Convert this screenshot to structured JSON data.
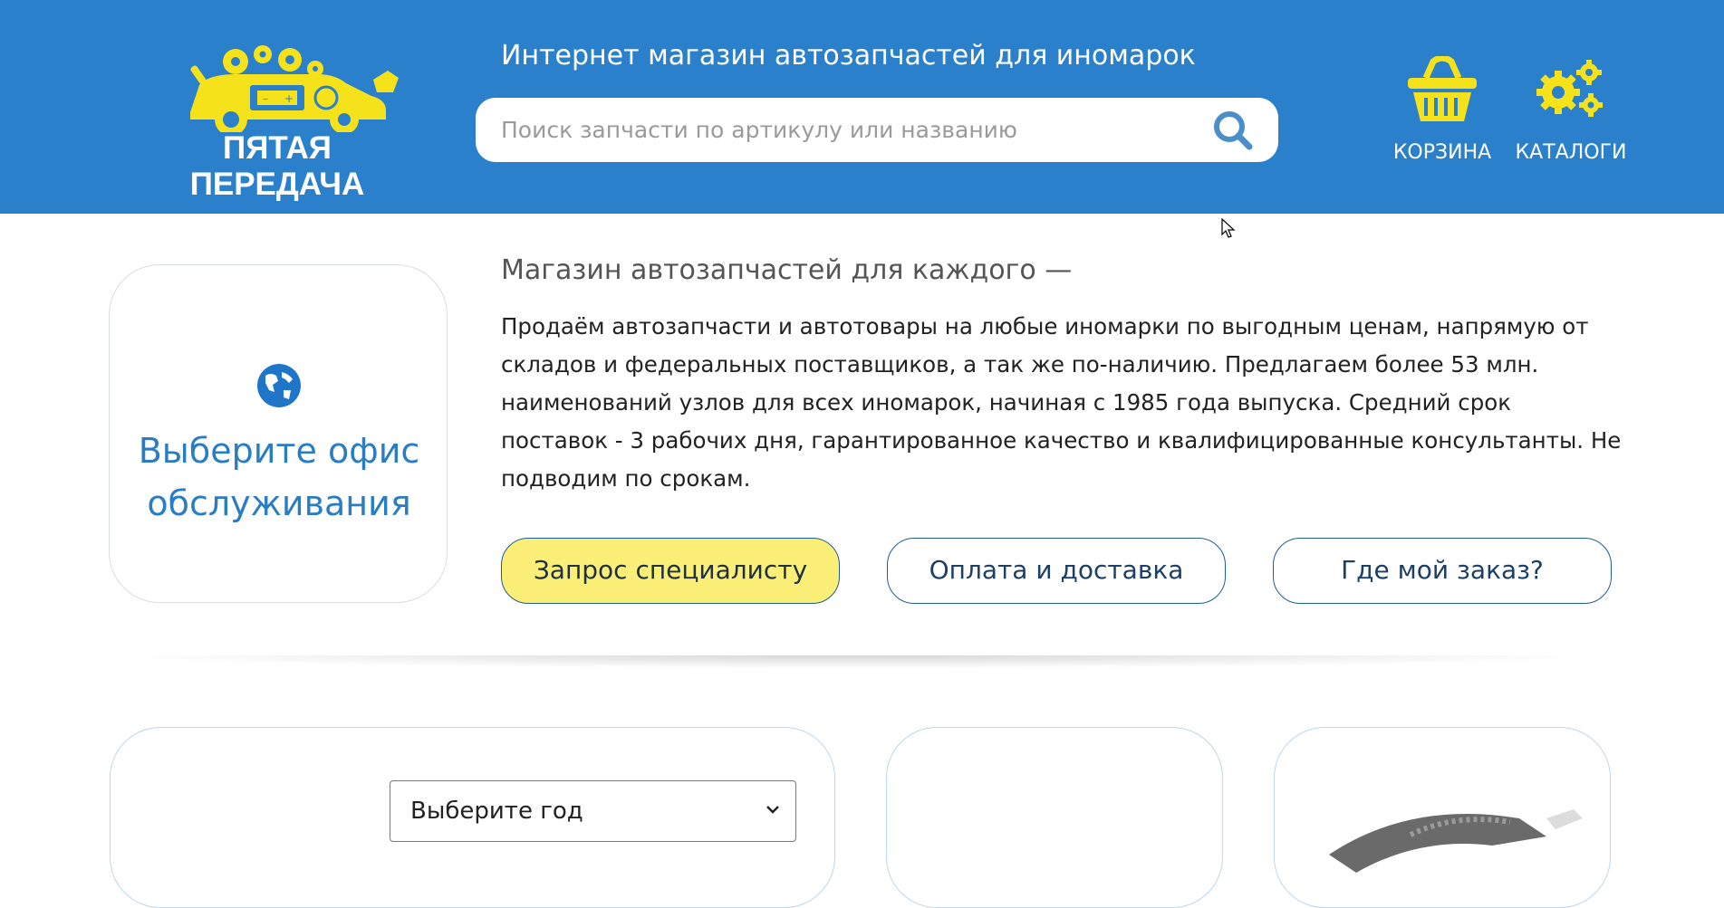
{
  "header": {
    "logo_text": "ПЯТАЯ ПЕРЕДАЧА",
    "title": "Интернет магазин автозапчастей для иномарок",
    "search_placeholder": "Поиск запчасти по артикулу или названию",
    "cart_label": "КОРЗИНА",
    "catalogs_label": "КАТАЛОГИ",
    "cart_icon": "basket-icon",
    "catalogs_icon": "gears-icon",
    "search_icon": "search-icon"
  },
  "intro": {
    "office_card_text": "Выберите офис обслуживания",
    "office_icon": "globe-icon",
    "title": "Магазин автозапчастей для каждого —",
    "text": "Продаём автозапчасти и автотовары на любые иномарки по выгодным ценам, напрямую от складов и федеральных поставщиков, а так же по-наличию. Предлагаем более 53 млн. наименований узлов для всех иномарок, начиная с 1985 года выпуска. Средний срок поставок - 3 рабочих дня, гарантированное качество и квалифицированные консультанты. Не подводим по срокам.",
    "buttons": [
      {
        "label": "Запрос специалисту"
      },
      {
        "label": "Оплата и доставка"
      },
      {
        "label": "Где мой заказ?"
      }
    ]
  },
  "filter": {
    "year_select_value": "Выберите год"
  },
  "colors": {
    "header_bg": "#2b80cb",
    "logo_yellow": "#f5e21a",
    "accent_blue": "#2b7dc3",
    "button_yellow": "#fcef77"
  }
}
